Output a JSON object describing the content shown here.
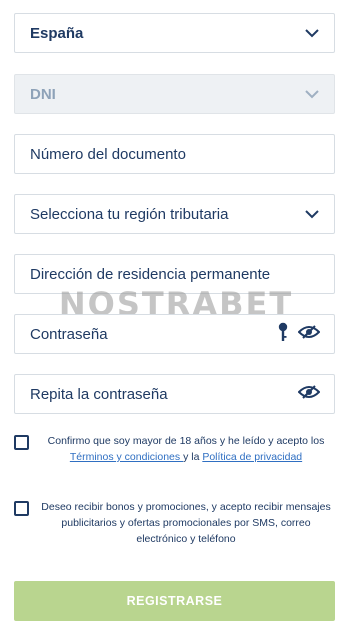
{
  "form": {
    "country": {
      "value": "España",
      "icon": "chevron-down-icon"
    },
    "id_type": {
      "value": "DNI",
      "icon": "chevron-down-icon"
    },
    "document_number": {
      "placeholder": "Número del documento"
    },
    "tax_region": {
      "value": "Selecciona tu región tributaria",
      "icon": "chevron-down-icon"
    },
    "address": {
      "placeholder": "Dirección de residencia permanente"
    },
    "password": {
      "placeholder": "Contraseña",
      "icons": [
        "key-icon",
        "eye-slash-icon"
      ]
    },
    "password_repeat": {
      "placeholder": "Repita la contraseña",
      "icons": [
        "eye-slash-icon"
      ]
    },
    "consent_age": {
      "text_before": "Confirmo que soy mayor de 18 años y he leído y acepto los",
      "terms_link": "Términos y condiciones ",
      "connector": " y la ",
      "privacy_link": "Política de privacidad"
    },
    "consent_marketing": {
      "text": "Deseo recibir bonos y promociones, y acepto recibir mensajes publicitarios y ofertas promocionales por SMS, correo electrónico y teléfono"
    },
    "submit_label": "REGISTRARSE"
  },
  "watermark": "NOSTRABET",
  "colors": {
    "text": "#1f3a63",
    "link": "#2f6fc2",
    "button_bg": "#b9d58f",
    "border": "#d7dde3",
    "disabled_bg": "#eef1f4",
    "disabled_text": "#8ea2b8"
  }
}
